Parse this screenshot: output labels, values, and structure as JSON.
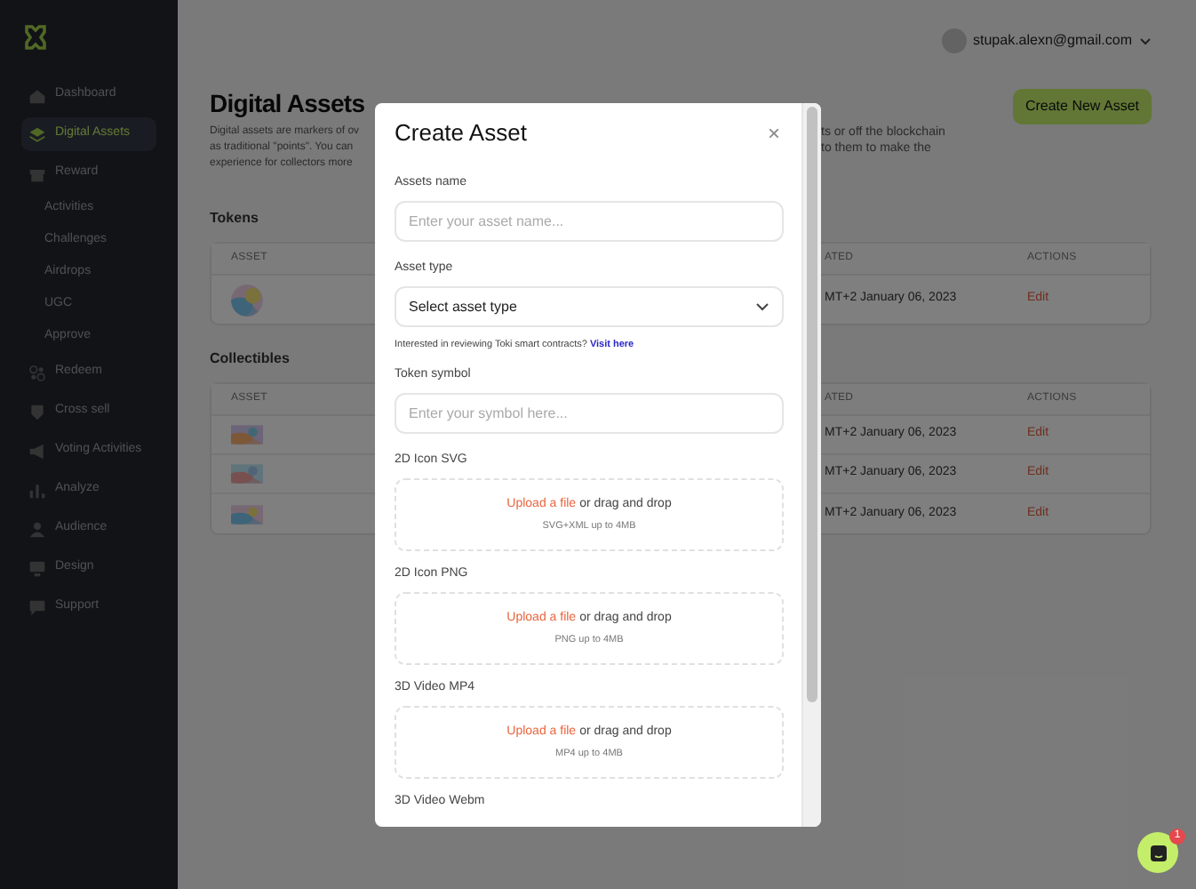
{
  "sidebar": {
    "items": [
      {
        "kind": "main",
        "label": "Dashboard",
        "selected": false
      },
      {
        "kind": "main",
        "label": "Digital Assets",
        "selected": true
      },
      {
        "kind": "main",
        "label": "Reward",
        "selected": false
      },
      {
        "kind": "sub",
        "label": "Activities",
        "selected": false
      },
      {
        "kind": "sub",
        "label": "Challenges",
        "selected": false
      },
      {
        "kind": "sub",
        "label": "Airdrops",
        "selected": false
      },
      {
        "kind": "sub",
        "label": "UGC",
        "selected": false
      },
      {
        "kind": "sub",
        "label": "Approve",
        "selected": false
      },
      {
        "kind": "main",
        "label": "Redeem",
        "selected": false
      },
      {
        "kind": "main",
        "label": "Cross sell",
        "selected": false
      },
      {
        "kind": "main",
        "label": "Voting Activities",
        "selected": false
      },
      {
        "kind": "main",
        "label": "Analyze",
        "selected": false
      },
      {
        "kind": "main",
        "label": "Audience",
        "selected": false
      },
      {
        "kind": "main",
        "label": "Design",
        "selected": false
      },
      {
        "kind": "main",
        "label": "Support",
        "selected": false
      }
    ]
  },
  "header": {
    "user_email": "stupak.alexn@gmail.com"
  },
  "page": {
    "title": "Digital Assets",
    "description_left": [
      "Digital assets are markers of ov",
      "as traditional \"points\". You can",
      "experience for collectors more"
    ],
    "description_right": [
      "ts or off the blockchain",
      "to them to make the"
    ],
    "create_button": "Create New Asset"
  },
  "sections": [
    {
      "title": "Tokens",
      "columns": [
        "ASSET",
        "ATED",
        "ACTIONS"
      ],
      "rows": [
        {
          "created": "MT+2 January 06, 2023",
          "action": "Edit"
        }
      ]
    },
    {
      "title": "Collectibles",
      "columns": [
        "ASSET",
        "ATED",
        "ACTIONS"
      ],
      "rows": [
        {
          "created": "MT+2 January 06, 2023",
          "action": "Edit"
        },
        {
          "created": "MT+2 January 06, 2023",
          "action": "Edit"
        },
        {
          "created": "MT+2 January 06, 2023",
          "action": "Edit"
        }
      ]
    }
  ],
  "modal": {
    "title": "Create Asset",
    "close": "×",
    "fields": [
      {
        "kind": "text",
        "label": "Assets name",
        "placeholder": "Enter your asset name..."
      },
      {
        "kind": "select",
        "label": "Asset type",
        "value": "Select asset type"
      },
      {
        "kind": "note",
        "text": "Interested in reviewing Toki smart contracts?",
        "link": "Visit here"
      },
      {
        "kind": "text",
        "label": "Token symbol",
        "placeholder": "Enter your symbol here..."
      },
      {
        "kind": "upload",
        "label": "2D Icon SVG",
        "link": "Upload a file",
        "text": "or drag and drop",
        "hint": "SVG+XML up to 4MB"
      },
      {
        "kind": "upload",
        "label": "2D Icon PNG",
        "link": "Upload a file",
        "text": "or drag and drop",
        "hint": "PNG up to 4MB"
      },
      {
        "kind": "upload",
        "label": "3D Video MP4",
        "link": "Upload a file",
        "text": "or drag and drop",
        "hint": "MP4 up to 4MB"
      },
      {
        "kind": "label",
        "label": "3D Video Webm"
      }
    ]
  },
  "chat": {
    "badge": "1"
  }
}
